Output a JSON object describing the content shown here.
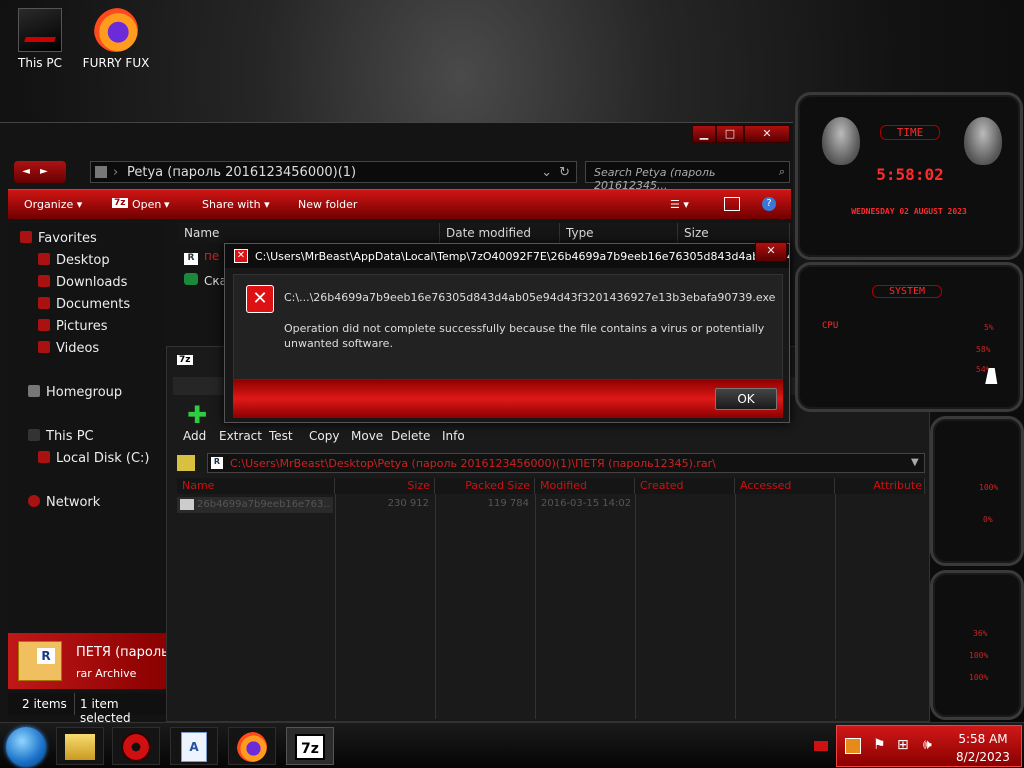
{
  "desktop": {
    "icons": [
      {
        "label": "This PC"
      },
      {
        "label": "FURRY FUX"
      }
    ]
  },
  "explorer": {
    "address": "Petya (пароль 2016123456000)(1)",
    "search_placeholder": "Search Petya (пароль 201612345...",
    "toolbar": {
      "organize": "Organize ▾",
      "open": "Open",
      "share": "Share with ▾",
      "new_folder": "New folder"
    },
    "sidebar": {
      "favorites": "Favorites",
      "desktop": "Desktop",
      "downloads": "Downloads",
      "documents": "Documents",
      "pictures": "Pictures",
      "videos": "Videos",
      "homegroup": "Homegroup",
      "this_pc": "This PC",
      "local_disk": "Local Disk (C:)",
      "network": "Network"
    },
    "columns": {
      "name": "Name",
      "date": "Date modified",
      "type": "Type",
      "size": "Size"
    },
    "files": [
      {
        "name": "пе"
      },
      {
        "name": "Ска"
      }
    ],
    "details": {
      "name": "ПЕТЯ (пароль",
      "type": "rar Archive"
    },
    "status": {
      "items": "2 items",
      "selected": "1 item selected"
    }
  },
  "sevenzip": {
    "toolbar": {
      "add": "Add",
      "extract": "Extract",
      "test": "Test",
      "copy": "Copy",
      "move": "Move",
      "delete": "Delete",
      "info": "Info"
    },
    "path": "C:\\Users\\MrBeast\\Desktop\\Petya (пароль 2016123456000)(1)\\ПЕТЯ (пароль12345).rar\\",
    "columns": {
      "name": "Name",
      "size": "Size",
      "packed": "Packed Size",
      "modified": "Modified",
      "created": "Created",
      "accessed": "Accessed",
      "attributes": "Attribute"
    },
    "row": {
      "name": "26b4699a7b9eeb16e763...",
      "size": "230 912",
      "packed": "119 784",
      "modified": "2016-03-15 14:02"
    }
  },
  "dialog": {
    "title": "C:\\Users\\MrBeast\\AppData\\Local\\Temp\\7zO40092F7E\\26b4699a7b9eeb16e76305d843d4ab05e94d43...",
    "file": "C:\\...\\26b4699a7b9eeb16e76305d843d4ab05e94d43f3201436927e13b3ebafa90739.exe",
    "message": "Operation did not complete successfully because the file contains a virus or potentially unwanted software.",
    "ok": "OK"
  },
  "gadgets": {
    "time_label": "TIME",
    "time": "5:58:02",
    "date": "WEDNESDAY 02 AUGUST 2023",
    "system_label": "SYSTEM",
    "cpu_label": "CPU",
    "readings": [
      "5%",
      "58%",
      "54%",
      "100%",
      "0%",
      "36%",
      "100%",
      "100%"
    ]
  },
  "taskbar": {
    "time": "5:58 AM",
    "date": "8/2/2023"
  }
}
